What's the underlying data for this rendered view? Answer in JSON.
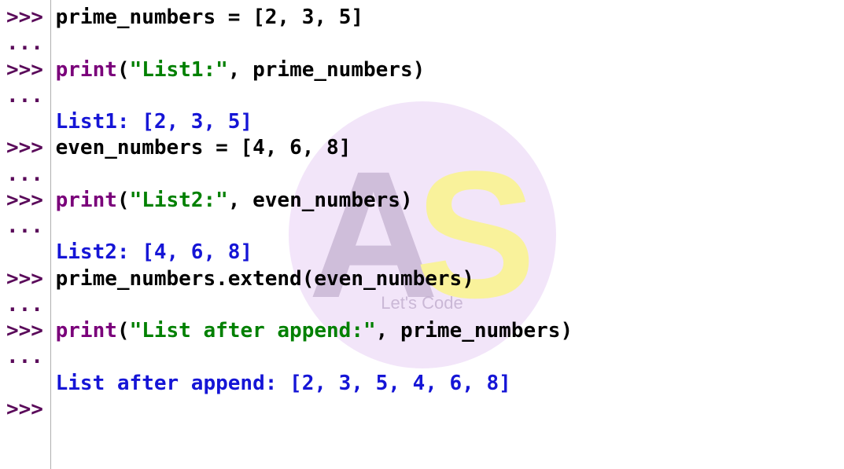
{
  "watermark": {
    "letter1": "A",
    "letter2": "S",
    "tagline": "Let's Code"
  },
  "lines": {
    "l1_prompt": ">>> ",
    "l1_var": "prime_numbers",
    "l1_eq": " = ",
    "l1_list_open": "[",
    "l1_n1": "2",
    "l1_c1": ", ",
    "l1_n2": "3",
    "l1_c2": ", ",
    "l1_n3": "5",
    "l1_list_close": "]",
    "l2_prompt": "...",
    "l3_prompt": ">>> ",
    "l3_func": "print",
    "l3_open": "(",
    "l3_str": "\"List1:\"",
    "l3_comma": ", ",
    "l3_var": "prime_numbers",
    "l3_close": ")",
    "l4_prompt": "...",
    "l5_pad": "    ",
    "l5_out": "List1: [2, 3, 5]",
    "l6_prompt": ">>> ",
    "l6_var": "even_numbers",
    "l6_eq": " = ",
    "l6_list_open": "[",
    "l6_n1": "4",
    "l6_c1": ", ",
    "l6_n2": "6",
    "l6_c2": ", ",
    "l6_n3": "8",
    "l6_list_close": "]",
    "l7_prompt": "...",
    "l8_prompt": ">>> ",
    "l8_func": "print",
    "l8_open": "(",
    "l8_str": "\"List2:\"",
    "l8_comma": ", ",
    "l8_var": "even_numbers",
    "l8_close": ")",
    "l9_prompt": "...",
    "l10_pad": "    ",
    "l10_out": "List2: [4, 6, 8]",
    "l11_prompt": ">>> ",
    "l11_var1": "prime_numbers",
    "l11_dot": ".",
    "l11_func": "extend",
    "l11_open": "(",
    "l11_var2": "even_numbers",
    "l11_close": ")",
    "l12_prompt": "...",
    "l13_prompt": ">>> ",
    "l13_func": "print",
    "l13_open": "(",
    "l13_str": "\"List after append:\"",
    "l13_comma": ", ",
    "l13_var": "prime_numbers",
    "l13_close": ")",
    "l14_prompt": "...",
    "l15_pad": "    ",
    "l15_out": "List after append: [2, 3, 5, 4, 6, 8]",
    "l16_prompt": ">>> "
  }
}
